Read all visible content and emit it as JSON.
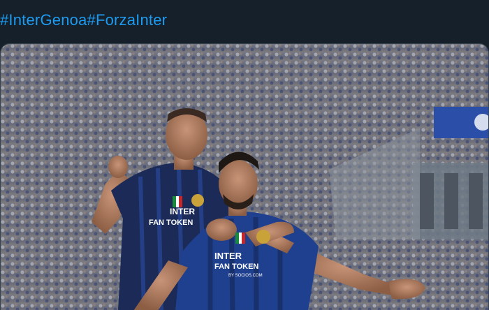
{
  "tweet": {
    "hashtags": [
      "#InterGenoa",
      "#ForzaInter"
    ]
  },
  "media": {
    "player_left_shirt": {
      "sponsor": "INTER",
      "sub": "FAN TOKEN"
    },
    "player_right_shirt": {
      "sponsor": "INTER",
      "sub": "FAN TOKEN",
      "small": "BY SOCIOS.COM"
    }
  },
  "colors": {
    "background": "#15202b",
    "hashtag": "#1d9bf0",
    "kit_navy": "#1b2a57",
    "kit_blue": "#1f3f8f"
  }
}
